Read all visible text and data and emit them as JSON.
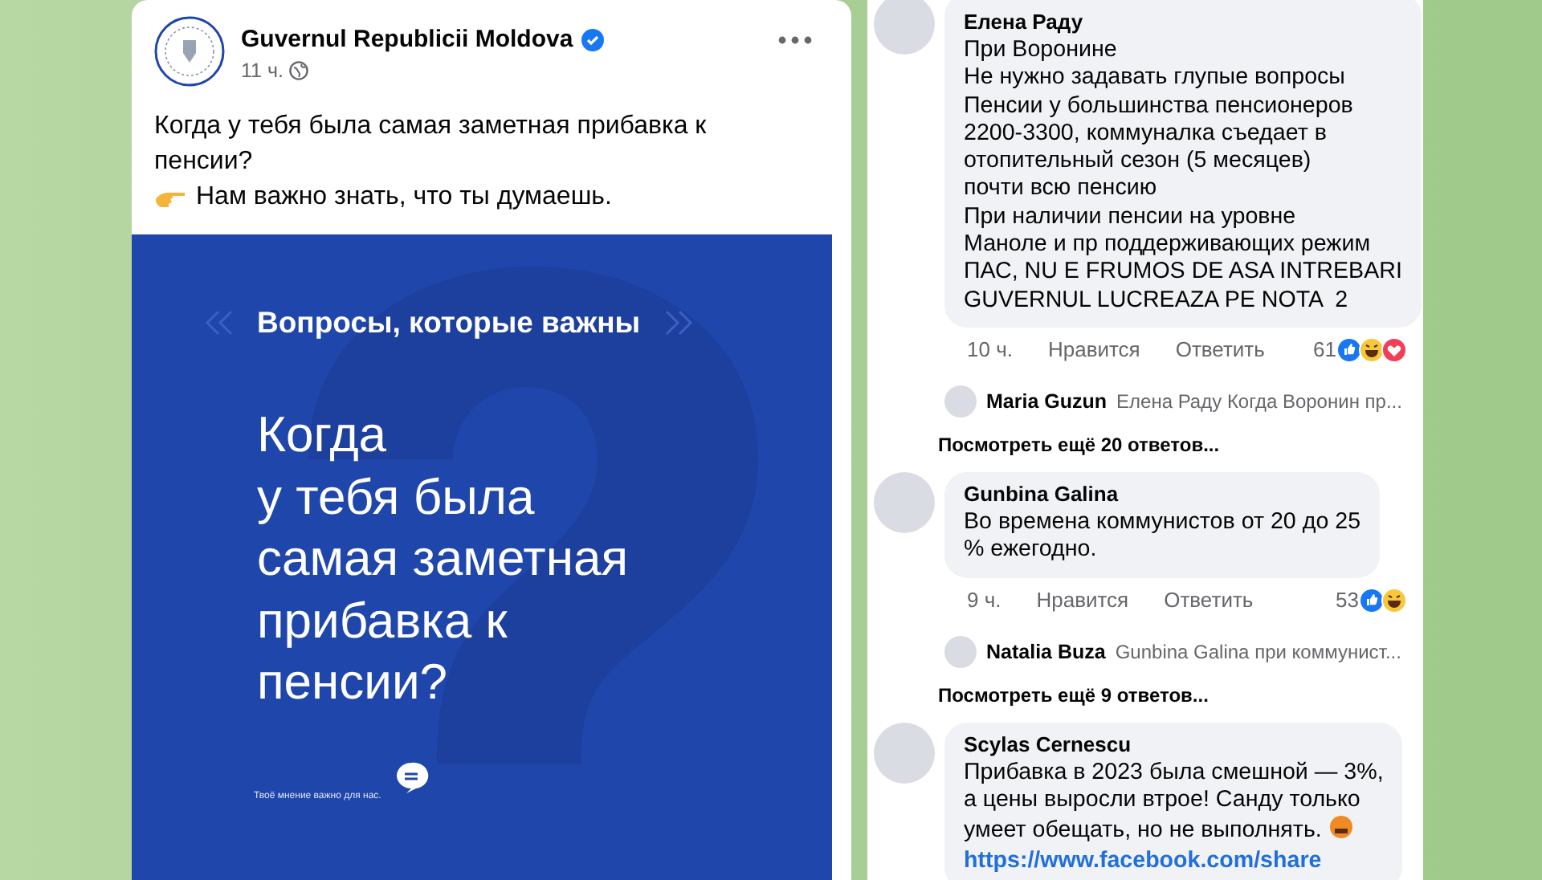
{
  "post": {
    "author": "Guvernul Republicii Moldova",
    "verified": true,
    "time": "11 ч.",
    "text": "Когда у тебя была самая заметная прибавка к пенсии?",
    "note": "Нам важно знать, что ты думаешь.",
    "image": {
      "heading": "Вопросы, которые важны",
      "question_lines": [
        "Когда",
        "у тебя была",
        "самая заметная",
        "прибавка к",
        "пенсии?"
      ],
      "footer": "Твоё мнение важно для нас."
    }
  },
  "comments": [
    {
      "author": "Елена Раду",
      "text": "При Воронине\nНе нужно задавать глупые вопросы\nПенсии у большинства пенсионеров\n2200-3300, коммуналка съедает в\nотопительный сезон (5 месяцев)\nпочти всю пенсию\nПри наличии пенсии на уровне\nМаноле и пр поддерживающих режим\nПАС, NU E FRUMOS DE ASA INTREBARI\nGUVERNUL LUCREAZA PE NOTA  2",
      "time": "10 ч.",
      "like": "Нравится",
      "reply": "Ответить",
      "reaction_count": "61",
      "reactions": {
        "like": true,
        "haha": true,
        "love": true
      },
      "replies": [
        {
          "author": "Maria Guzun",
          "text": "Елена Раду Когда Воронин пр..."
        }
      ],
      "more_replies": "Посмотреть ещё 20 ответов..."
    },
    {
      "author": "Gunbina Galina",
      "text": "Во времена коммунистов от 20 до 25\n% ежегодно.",
      "time": "9 ч.",
      "like": "Нравится",
      "reply": "Ответить",
      "reaction_count": "53",
      "reactions": {
        "like": true,
        "haha": true,
        "love": false
      },
      "replies": [
        {
          "author": "Natalia Buza",
          "text": "Gunbina Galina при коммунист..."
        }
      ],
      "more_replies": "Посмотреть ещё 9 ответов..."
    },
    {
      "author": "Scylas Cernescu",
      "text": "Прибавка в 2023 была смешной — 3%,\nа цены выросли втрое! Санду только\nумеет обещать, но не выполнять.",
      "emoji": true,
      "link": "https://www.facebook.com/share"
    }
  ]
}
